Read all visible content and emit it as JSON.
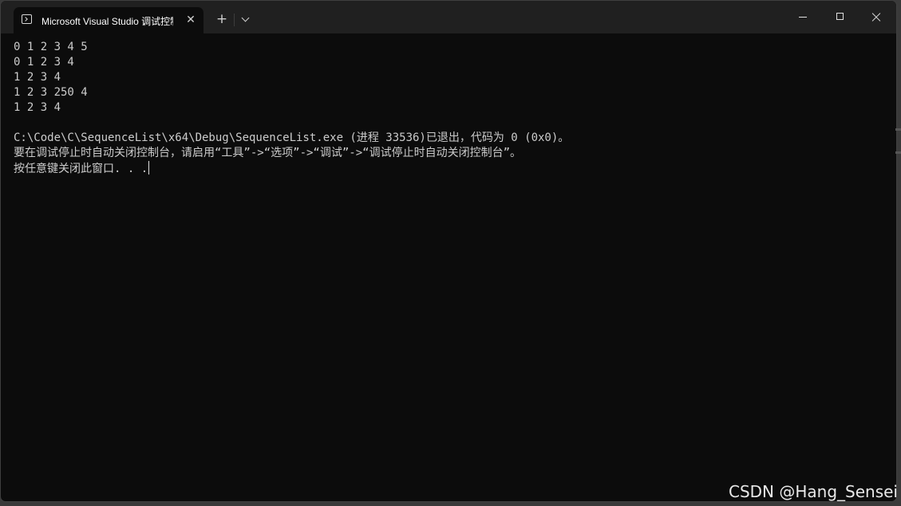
{
  "window": {
    "tab_title": "Microsoft Visual Studio 调试控制台",
    "tab_close_icon": "close-icon",
    "new_tab_icon": "plus-icon",
    "dropdown_icon": "chevron-down-icon",
    "minimize_icon": "minimize-icon",
    "maximize_icon": "maximize-icon",
    "close_icon": "close-icon"
  },
  "console": {
    "lines": [
      "0 1 2 3 4 5",
      "0 1 2 3 4",
      "1 2 3 4",
      "1 2 3 250 4",
      "1 2 3 4",
      "",
      "C:\\Code\\C\\SequenceList\\x64\\Debug\\SequenceList.exe (进程 33536)已退出，代码为 0 (0x0)。",
      "要在调试停止时自动关闭控制台，请启用“工具”->“选项”->“调试”->“调试停止时自动关闭控制台”。",
      "按任意键关闭此窗口. . ."
    ]
  },
  "watermark": "CSDN @Hang_Sensei",
  "colors": {
    "background": "#0c0c0c",
    "titlebar": "#202020",
    "text": "#cccccc"
  }
}
